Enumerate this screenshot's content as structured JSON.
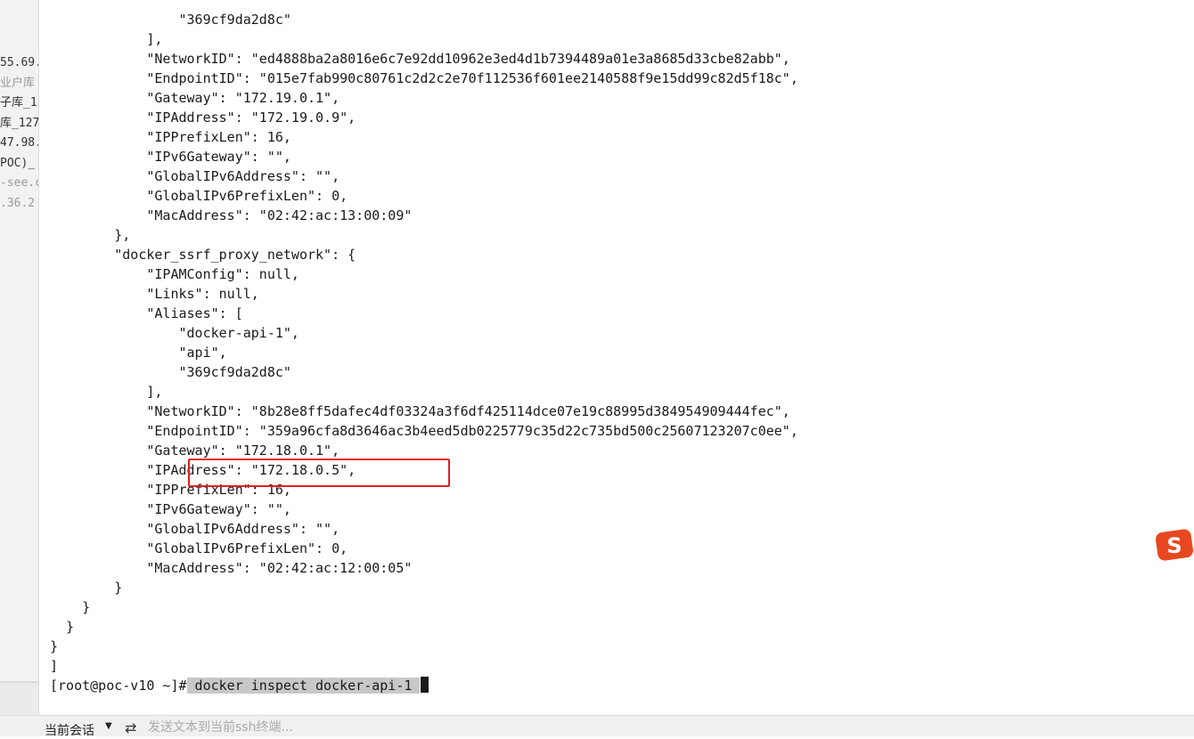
{
  "sidebar": {
    "items": [
      {
        "text": "55.69.",
        "dim": false
      },
      {
        "text": "业户库",
        "dim": true
      },
      {
        "text": "子库_1",
        "dim": false
      },
      {
        "text": "库_127",
        "dim": false
      },
      {
        "text": "47.98.",
        "dim": false
      },
      {
        "text": "POC)_",
        "dim": false
      },
      {
        "text": "-see.c",
        "dim": true
      },
      {
        "text": ".36.2",
        "dim": true
      }
    ]
  },
  "terminal": {
    "lines": [
      "                \"369cf9da2d8c\"",
      "            ],",
      "            \"NetworkID\": \"ed4888ba2a8016e6c7e92dd10962e3ed4d1b7394489a01e3a8685d33cbe82abb\",",
      "            \"EndpointID\": \"015e7fab990c80761c2d2c2e70f112536f601ee2140588f9e15dd99c82d5f18c\",",
      "            \"Gateway\": \"172.19.0.1\",",
      "            \"IPAddress\": \"172.19.0.9\",",
      "            \"IPPrefixLen\": 16,",
      "            \"IPv6Gateway\": \"\",",
      "            \"GlobalIPv6Address\": \"\",",
      "            \"GlobalIPv6PrefixLen\": 0,",
      "            \"MacAddress\": \"02:42:ac:13:00:09\"",
      "        },",
      "        \"docker_ssrf_proxy_network\": {",
      "            \"IPAMConfig\": null,",
      "            \"Links\": null,",
      "            \"Aliases\": [",
      "                \"docker-api-1\",",
      "                \"api\",",
      "                \"369cf9da2d8c\"",
      "            ],",
      "            \"NetworkID\": \"8b28e8ff5dafec4df03324a3f6df425114dce07e19c88995d384954909444fec\",",
      "            \"EndpointID\": \"359a96cfa8d3646ac3b4eed5db0225779c35d22c735bd500c25607123207c0ee\",",
      "            \"Gateway\": \"172.18.0.1\",",
      "            \"IPAddress\": \"172.18.0.5\",",
      "            \"IPPrefixLen\": 16,",
      "            \"IPv6Gateway\": \"\",",
      "            \"GlobalIPv6Address\": \"\",",
      "            \"GlobalIPv6PrefixLen\": 0,",
      "            \"MacAddress\": \"02:42:ac:12:00:05\"",
      "        }",
      "    }",
      "  }",
      "}",
      "]"
    ],
    "prompt": "[root@poc-v10 ~]#",
    "command": " docker inspect docker-api-1 "
  },
  "ime": {
    "glyph": "S",
    "color": "#e8481f"
  },
  "bottom": {
    "session_label": "当前会话",
    "send_placeholder": "发送文本到当前ssh终端..."
  }
}
